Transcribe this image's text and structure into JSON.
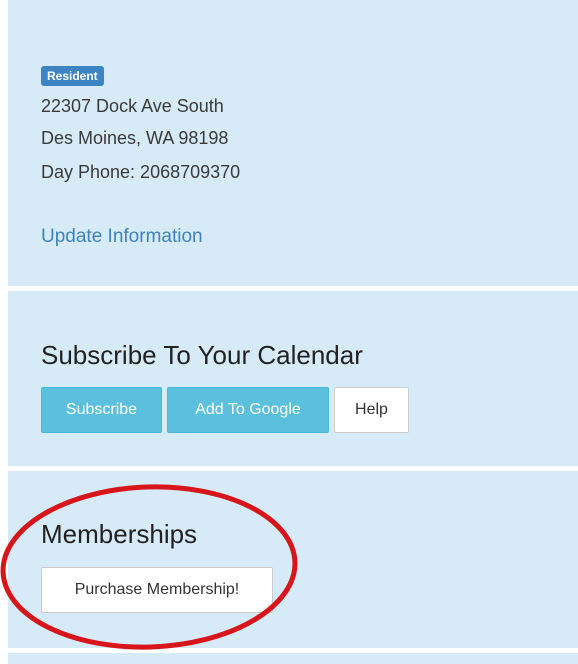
{
  "top_fragment": "...",
  "account": {
    "badge": "Resident",
    "address_line1": "22307 Dock Ave South",
    "address_line2": "Des Moines, WA 98198",
    "day_phone": "Day Phone: 2068709370",
    "update_link": "Update Information"
  },
  "calendar": {
    "title": "Subscribe To Your Calendar",
    "subscribe_label": "Subscribe",
    "add_google_label": "Add To Google",
    "help_label": "Help"
  },
  "memberships": {
    "title": "Memberships",
    "purchase_label": "Purchase Membership!"
  },
  "colors": {
    "panel_bg": "#d7eaf7",
    "badge_bg": "#3c84c3",
    "link": "#3f82c4",
    "info_button": "#5bc0de",
    "annotation_circle": "#d7151a"
  }
}
